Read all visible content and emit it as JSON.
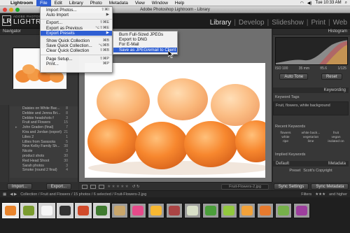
{
  "menubar": {
    "app": "Lightroom",
    "items": [
      "File",
      "Edit",
      "Library",
      "Photo",
      "Metadata",
      "View",
      "Window",
      "Help"
    ],
    "active": "File",
    "status": "Tue 10:33 AM"
  },
  "window": {
    "title": "Adobe Photoshop Lightroom - Library"
  },
  "identity": {
    "small": "ADOBE PHOTOSHOP",
    "big": "LIGHTROOM",
    "badge": "LR"
  },
  "modules": [
    "Library",
    "Develop",
    "Slideshow",
    "Print",
    "Web"
  ],
  "file_menu": [
    {
      "label": "Import Photos...",
      "shortcut": "⇧⌘I"
    },
    {
      "label": "Auto Import",
      "shortcut": "▶"
    },
    {
      "sep": true
    },
    {
      "label": "Export...",
      "shortcut": "⇧⌘E"
    },
    {
      "label": "Export as Previous",
      "shortcut": "⌥⇧⌘E"
    },
    {
      "label": "Export Presets",
      "shortcut": "▶",
      "highlight": true
    },
    {
      "sep": true
    },
    {
      "label": "Show Quick Collection",
      "shortcut": "⌘B"
    },
    {
      "label": "Save Quick Collection...",
      "shortcut": "⌥⌘B"
    },
    {
      "label": "Clear Quick Collection",
      "shortcut": "⇧⌘B"
    },
    {
      "sep": true
    },
    {
      "label": "Page Setup...",
      "shortcut": "⇧⌘P"
    },
    {
      "label": "Print...",
      "shortcut": "⌘P"
    }
  ],
  "export_presets": [
    {
      "label": "Burn Full-Sized JPEGs"
    },
    {
      "label": "Export to DNG"
    },
    {
      "label": "For E-Mail"
    },
    {
      "label": "Save as JPEG/email to Client",
      "highlight": true
    }
  ],
  "left_panel": {
    "navigator": "Navigator",
    "folders": [
      {
        "name": "Daisies on White Bac...",
        "count": "8"
      },
      {
        "name": "Debbie and Jenna Bri...",
        "count": "8"
      },
      {
        "name": "Debbie headshots f",
        "count": "3"
      },
      {
        "name": "Fruit and Flowers",
        "count": "15"
      },
      {
        "name": "John Graden (final)",
        "count": "7",
        "expand": true
      },
      {
        "name": "Kira and Jordan (export)",
        "count": "21"
      },
      {
        "name": "Lilies 2",
        "count": "1"
      },
      {
        "name": "Lillies from Sarasota",
        "count": "5"
      },
      {
        "name": "New Kelby Family Sh...",
        "count": "38"
      },
      {
        "name": "Nicole",
        "count": "3"
      },
      {
        "name": "product shots",
        "count": "30"
      },
      {
        "name": "Red Head Shoot",
        "count": "30"
      },
      {
        "name": "Sarah photos",
        "count": "3"
      },
      {
        "name": "Smoke (round 2 final)",
        "count": "4"
      }
    ],
    "import_label": "Import...",
    "export_label": "Export..."
  },
  "right_panel": {
    "histogram": "Histogram",
    "histo_info": [
      "ISO 100",
      "35 mm",
      "f/5.6",
      "1/125"
    ],
    "auto_tone": "Auto Tone",
    "reset": "Reset",
    "keywording": "Keywording",
    "keyword_tags": "Keyword Tags",
    "keywords_value": "Fruit, flowers, white background",
    "recent_keywords": "Recent Keywords",
    "kw_grid": [
      "flowers",
      "white back...",
      "fruit",
      "white",
      "vegetarian",
      "vegan",
      "ripe",
      "lime",
      "isolated on"
    ],
    "implied_keywords": "Implied Keywords",
    "metadata": "Metadata",
    "default_label": "Default",
    "preset_label": "Preset",
    "preset_value": "Scott's Copyright",
    "sync_settings": "Sync Settings",
    "sync_metadata": "Sync Metadata"
  },
  "toolbar": {
    "filename": "Fruit-Flowers-2.jpg",
    "stars": "★★★★★"
  },
  "filmstrip": {
    "breadcrumb": "Collection / Fruit and Flowers / 15 photos / 6 selected / Fruit-Flowers-2.jpg",
    "filters": "Filters",
    "and_higher": "and higher",
    "thumb_colors": [
      "#e8842c",
      "#7a9b2e",
      "#f5f5f5",
      "#333333",
      "#d04a2a",
      "#3f7a2f",
      "#c9a66b",
      "#e64a8a",
      "#f7b731",
      "#a44",
      "#d9e0c8",
      "#4b9e3a",
      "#92c83e",
      "#f2a23a",
      "#e67a2e",
      "#76b04a",
      "#9d3f9e"
    ]
  },
  "cursor": "pointer-cursor"
}
